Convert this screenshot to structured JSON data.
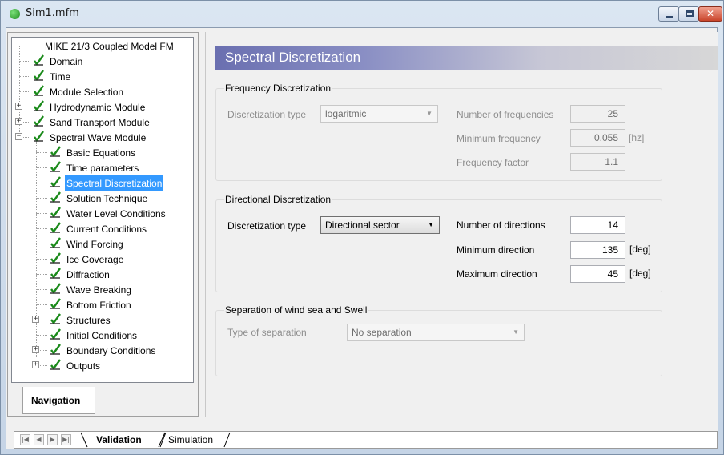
{
  "window": {
    "title": "Sim1.mfm",
    "buttons": {
      "minimize": "–",
      "maximize": "□",
      "close": "✕"
    }
  },
  "tree": {
    "items": [
      {
        "label": "MIKE 21/3 Coupled Model FM",
        "checked": false,
        "expander": ""
      },
      {
        "label": "Domain",
        "checked": true,
        "expander": ""
      },
      {
        "label": "Time",
        "checked": true,
        "expander": ""
      },
      {
        "label": "Module Selection",
        "checked": true,
        "expander": ""
      },
      {
        "label": "Hydrodynamic Module",
        "checked": true,
        "expander": "+"
      },
      {
        "label": "Sand Transport Module",
        "checked": true,
        "expander": "+"
      },
      {
        "label": "Spectral Wave Module",
        "checked": true,
        "expander": "−"
      },
      {
        "label": "Basic Equations",
        "checked": true,
        "expander": ""
      },
      {
        "label": "Time parameters",
        "checked": true,
        "expander": ""
      },
      {
        "label": "Spectral Discretization",
        "checked": true,
        "expander": "",
        "selected": true
      },
      {
        "label": "Solution Technique",
        "checked": true,
        "expander": ""
      },
      {
        "label": "Water Level Conditions",
        "checked": true,
        "expander": ""
      },
      {
        "label": "Current Conditions",
        "checked": true,
        "expander": ""
      },
      {
        "label": "Wind Forcing",
        "checked": true,
        "expander": ""
      },
      {
        "label": "Ice Coverage",
        "checked": true,
        "expander": ""
      },
      {
        "label": "Diffraction",
        "checked": true,
        "expander": ""
      },
      {
        "label": "Wave Breaking",
        "checked": true,
        "expander": ""
      },
      {
        "label": "Bottom Friction",
        "checked": true,
        "expander": ""
      },
      {
        "label": "Structures",
        "checked": true,
        "expander": "+"
      },
      {
        "label": "Initial Conditions",
        "checked": true,
        "expander": ""
      },
      {
        "label": "Boundary Conditions",
        "checked": true,
        "expander": "+"
      },
      {
        "label": "Outputs",
        "checked": true,
        "expander": "+"
      }
    ],
    "check_color": "#1a8a1a"
  },
  "nav_tab": "Navigation",
  "header": {
    "title": "Spectral Discretization"
  },
  "frequency": {
    "title": "Frequency Discretization",
    "type_label": "Discretization type",
    "type_value": "logaritmic",
    "num_label": "Number of frequencies",
    "num_value": "25",
    "min_label": "Minimum frequency",
    "min_value": "0.055",
    "min_unit": "[hz]",
    "factor_label": "Frequency factor",
    "factor_value": "1.1"
  },
  "directional": {
    "title": "Directional Discretization",
    "type_label": "Discretization type",
    "type_value": "Directional sector",
    "num_label": "Number of directions",
    "num_value": "14",
    "min_label": "Minimum direction",
    "min_value": "135",
    "min_unit": "[deg]",
    "max_label": "Maximum direction",
    "max_value": "45",
    "max_unit": "[deg]"
  },
  "separation": {
    "title": "Separation of wind sea and Swell",
    "type_label": "Type of separation",
    "type_value": "No separation"
  },
  "bottom_tabs": {
    "nav_first": "|◀",
    "nav_prev": "◀",
    "nav_next": "▶",
    "nav_last": "▶|",
    "validation": "Validation",
    "simulation": "Simulation"
  }
}
